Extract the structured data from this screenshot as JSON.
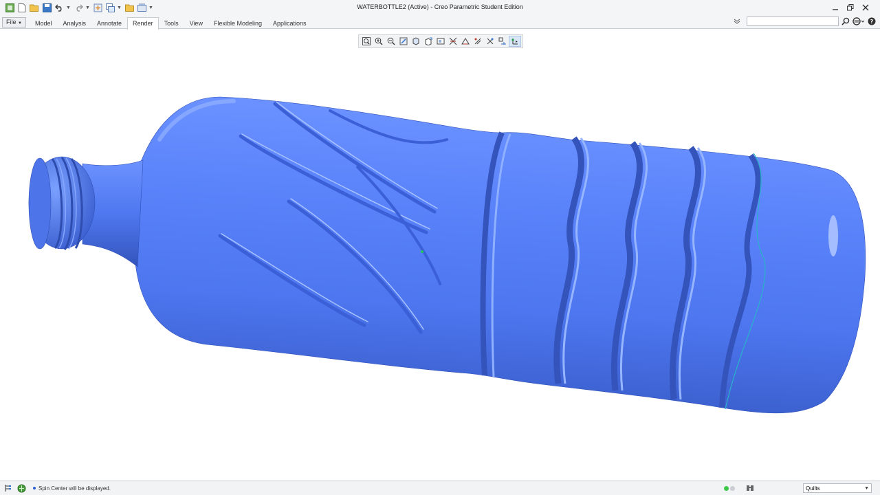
{
  "window": {
    "title": "WATERBOTTLE2 (Active) - Creo Parametric Student Edition"
  },
  "quick_access": {
    "icons": [
      "app-logo-icon",
      "new-file-icon",
      "open-folder-icon",
      "save-icon",
      "undo-icon",
      "redo-icon",
      "regenerate-icon",
      "windows-icon",
      "close-window-icon",
      "customize-icon"
    ]
  },
  "ribbon": {
    "file_label": "File",
    "tabs": [
      {
        "label": "Model"
      },
      {
        "label": "Analysis"
      },
      {
        "label": "Annotate"
      },
      {
        "label": "Render"
      },
      {
        "label": "Tools"
      },
      {
        "label": "View"
      },
      {
        "label": "Flexible Modeling"
      },
      {
        "label": "Applications"
      }
    ],
    "active_tab": "Render",
    "search": {
      "value": "",
      "placeholder": ""
    }
  },
  "view_toolbar": {
    "tools": [
      "refit",
      "zoom-in",
      "zoom-out",
      "repaint",
      "display-style",
      "saved-orientations",
      "view-manager",
      "datum-display",
      "annotation-display",
      "spin-center"
    ]
  },
  "model": {
    "name": "WATERBOTTLE2",
    "color": "#4f79f2",
    "highlight_color": "#9bb8ff",
    "shadow_color": "#3457c4"
  },
  "statusbar": {
    "message": "Spin Center will be displayed.",
    "filter_value": "Quilts",
    "lights": [
      "#3ec94a",
      "#c9ccd1"
    ]
  }
}
